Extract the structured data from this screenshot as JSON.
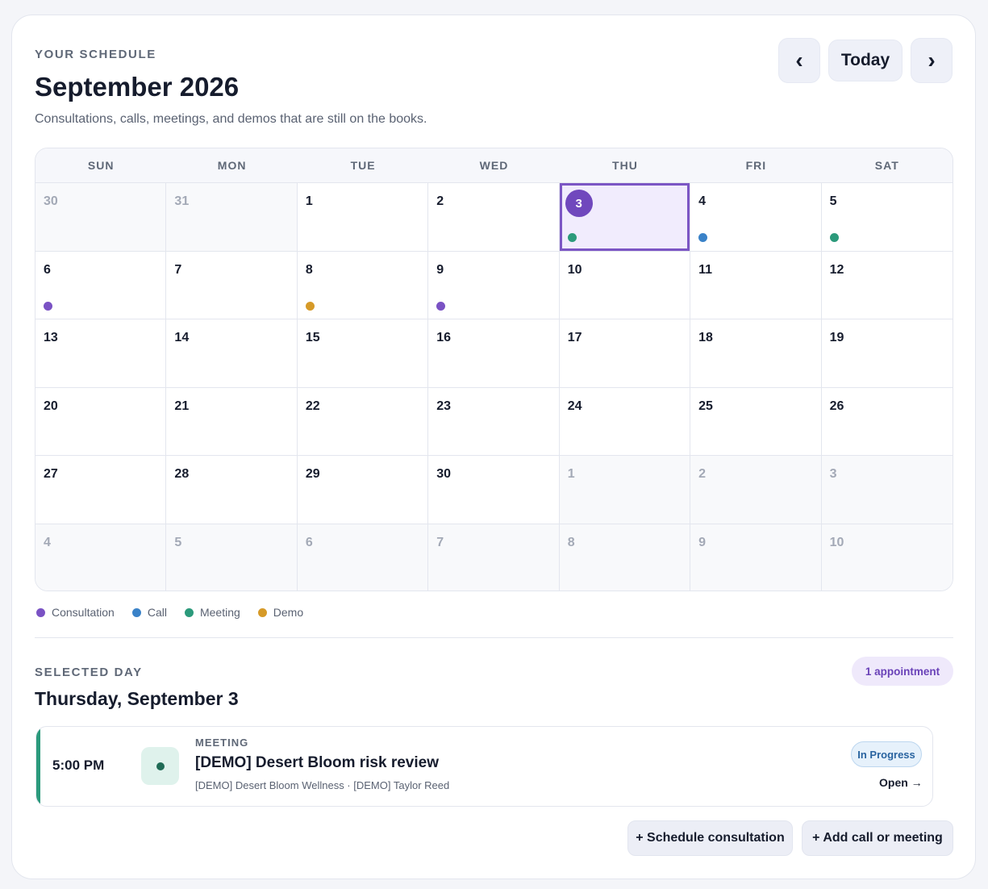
{
  "header": {
    "eyebrow": "YOUR SCHEDULE",
    "title": "September 2026",
    "subtitle": "Consultations, calls, meetings, and demos that are still on the books.",
    "prev_label": "‹",
    "today_label": "Today",
    "next_label": "›"
  },
  "calendar": {
    "weekdays": [
      "SUN",
      "MON",
      "TUE",
      "WED",
      "THU",
      "FRI",
      "SAT"
    ],
    "days": [
      {
        "n": "30",
        "outside": true
      },
      {
        "n": "31",
        "outside": true
      },
      {
        "n": "1"
      },
      {
        "n": "2"
      },
      {
        "n": "3",
        "selected": true,
        "dot": "meeting"
      },
      {
        "n": "4",
        "dot": "call"
      },
      {
        "n": "5",
        "dot": "meeting"
      },
      {
        "n": "6",
        "dot": "consultation"
      },
      {
        "n": "7"
      },
      {
        "n": "8",
        "dot": "demo"
      },
      {
        "n": "9",
        "dot": "consultation"
      },
      {
        "n": "10"
      },
      {
        "n": "11"
      },
      {
        "n": "12"
      },
      {
        "n": "13"
      },
      {
        "n": "14"
      },
      {
        "n": "15"
      },
      {
        "n": "16"
      },
      {
        "n": "17"
      },
      {
        "n": "18"
      },
      {
        "n": "19"
      },
      {
        "n": "20"
      },
      {
        "n": "21"
      },
      {
        "n": "22"
      },
      {
        "n": "23"
      },
      {
        "n": "24"
      },
      {
        "n": "25"
      },
      {
        "n": "26"
      },
      {
        "n": "27"
      },
      {
        "n": "28"
      },
      {
        "n": "29"
      },
      {
        "n": "30"
      },
      {
        "n": "1",
        "outside": true
      },
      {
        "n": "2",
        "outside": true
      },
      {
        "n": "3",
        "outside": true
      },
      {
        "n": "4",
        "outside": true
      },
      {
        "n": "5",
        "outside": true
      },
      {
        "n": "6",
        "outside": true
      },
      {
        "n": "7",
        "outside": true
      },
      {
        "n": "8",
        "outside": true
      },
      {
        "n": "9",
        "outside": true
      },
      {
        "n": "10",
        "outside": true
      }
    ]
  },
  "legend": [
    {
      "key": "consultation",
      "label": "Consultation"
    },
    {
      "key": "call",
      "label": "Call"
    },
    {
      "key": "meeting",
      "label": "Meeting"
    },
    {
      "key": "demo",
      "label": "Demo"
    }
  ],
  "colors": {
    "consultation": "#7a52c4",
    "call": "#3a82c8",
    "meeting": "#2c9a7b",
    "demo": "#d69a28",
    "accent": "#7048bd"
  },
  "selected_day": {
    "eyebrow": "SELECTED DAY",
    "title": "Thursday, September 3",
    "count_badge": "1 appointment",
    "appointment": {
      "time": "5:00 PM",
      "type": "MEETING",
      "title": "[DEMO] Desert Bloom risk review",
      "meta": "[DEMO] Desert Bloom Wellness · [DEMO] Taylor Reed",
      "status": "In Progress",
      "open_label": "Open →",
      "icon": "meeting-dot-icon"
    }
  },
  "actions": {
    "schedule_consultation": "+ Schedule consultation",
    "add_call_meeting": "+ Add call or meeting"
  }
}
